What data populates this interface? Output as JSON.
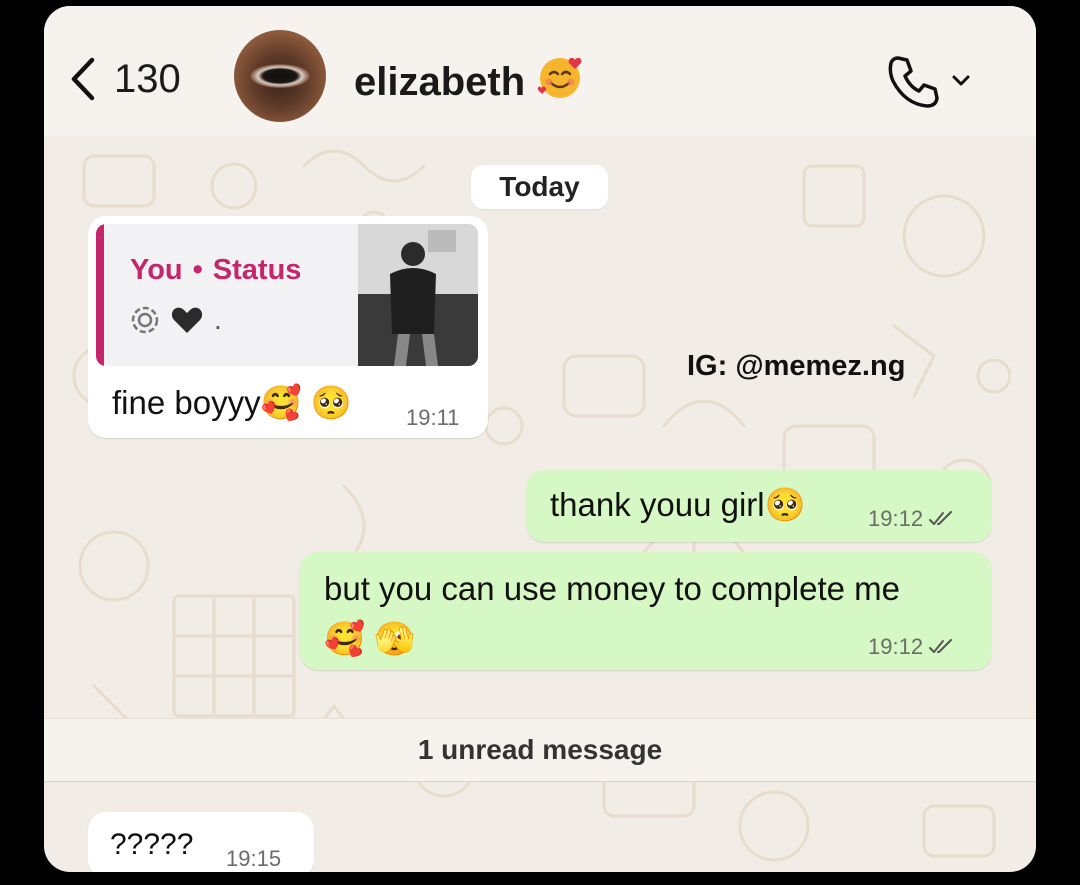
{
  "header": {
    "back_count": "130",
    "contact_name": "elizabeth",
    "name_emoji": "🥰"
  },
  "chat": {
    "date_label": "Today",
    "watermark": "IG: @memez.ng",
    "messages": [
      {
        "direction": "incoming",
        "reply": {
          "author": "You",
          "separator": "•",
          "source": "Status",
          "content_emoji": "🖤",
          "content_suffix": "."
        },
        "text": "fine boyyy🥰 🥺",
        "time": "19:11"
      },
      {
        "direction": "outgoing",
        "text": "thank youu girl🥺",
        "time": "19:12",
        "status": "read"
      },
      {
        "direction": "outgoing",
        "text": "but you can use money to complete me",
        "text_line2": "🥰 🫣",
        "time": "19:12",
        "status": "read"
      },
      {
        "direction": "incoming",
        "text": "?????",
        "time": "19:15"
      }
    ],
    "unread_label": "1 unread message"
  },
  "colors": {
    "outgoing_bubble": "#d6f8c4",
    "incoming_bubble": "#ffffff",
    "reply_accent": "#c4256b",
    "wallpaper": "#f1ede6"
  }
}
